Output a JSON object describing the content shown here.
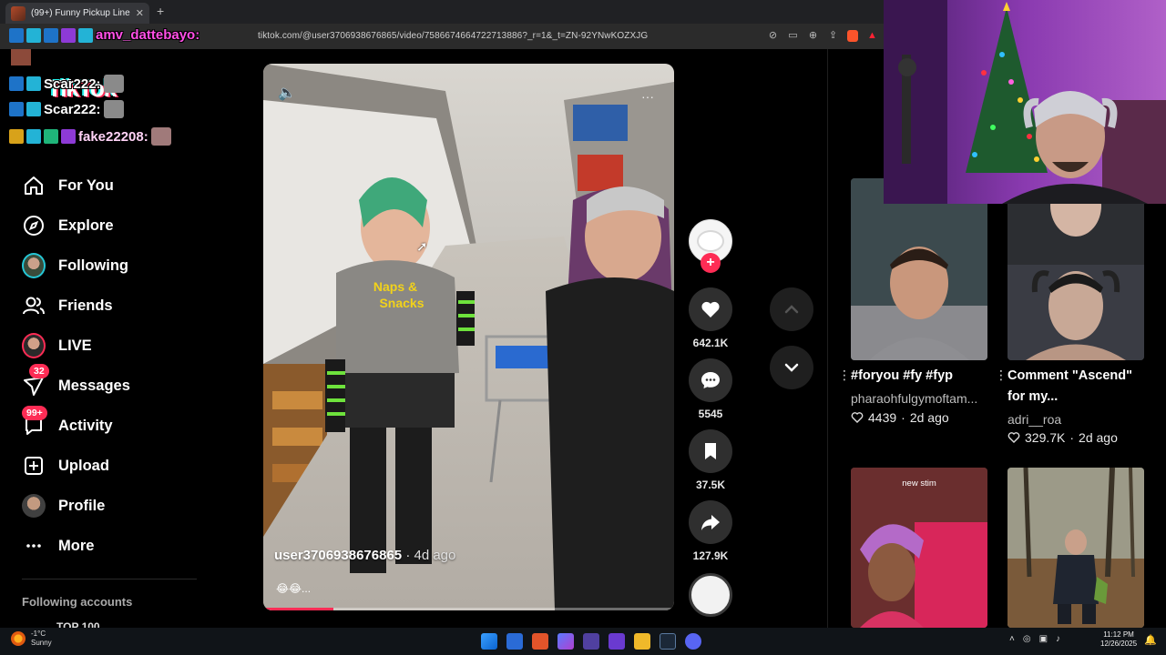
{
  "browser": {
    "tab_title": "(99+) Funny Pickup Line Atte...",
    "tab_close": "✕",
    "tab_new": "+",
    "url": "tiktok.com/@user3706938676865/video/7586674664722713886?_r=1&_t=ZN-92YNwKOZXJG"
  },
  "overlay_chat": {
    "rows": [
      {
        "name": "amv_dattebayo:"
      },
      {
        "name": "Scar222:"
      },
      {
        "name": "Scar222:"
      },
      {
        "name": "fake22208:"
      }
    ]
  },
  "tiktok": {
    "logo": "TikTok",
    "nav": [
      {
        "id": "for-you",
        "label": "For You",
        "icon": "home-icon"
      },
      {
        "id": "explore",
        "label": "Explore",
        "icon": "compass-icon"
      },
      {
        "id": "following",
        "label": "Following",
        "icon": "avatar"
      },
      {
        "id": "friends",
        "label": "Friends",
        "icon": "friends-icon"
      },
      {
        "id": "live",
        "label": "LIVE",
        "icon": "avatar"
      },
      {
        "id": "messages",
        "label": "Messages",
        "icon": "messages-icon",
        "badge": "32"
      },
      {
        "id": "activity",
        "label": "Activity",
        "icon": "activity-icon",
        "badge": "99+"
      },
      {
        "id": "upload",
        "label": "Upload",
        "icon": "upload-icon"
      },
      {
        "id": "profile",
        "label": "Profile",
        "icon": "avatar"
      },
      {
        "id": "more",
        "label": "More",
        "icon": "more-icon"
      }
    ],
    "following_accounts_header": "Following accounts",
    "following_first": "TOP 100"
  },
  "video": {
    "author": "user3706938676865",
    "time_ago": "· 4d ago",
    "caption": "😂😂...",
    "progress_fraction": 0.17
  },
  "actions": {
    "likes": "642.1K",
    "comments": "5545",
    "saves": "37.5K",
    "shares": "127.9K"
  },
  "recommended": [
    {
      "title": "#foryou #fy #fyp",
      "author": "pharaohfulgymoftam...",
      "likes": "4439",
      "age": "2d ago"
    },
    {
      "title": "Comment \"Ascend\" for my...",
      "author": "adri__roa",
      "likes": "329.7K",
      "age": "2d ago"
    },
    {
      "thumb_text": "new stim"
    },
    {}
  ],
  "taskbar": {
    "temp": "-1°C",
    "condition": "Sunny",
    "time": "11:12 PM",
    "date": "12/26/2025"
  },
  "colors": {
    "accent": "#fe2c55",
    "background": "#000000",
    "button_bg": "#2f2f2f"
  }
}
